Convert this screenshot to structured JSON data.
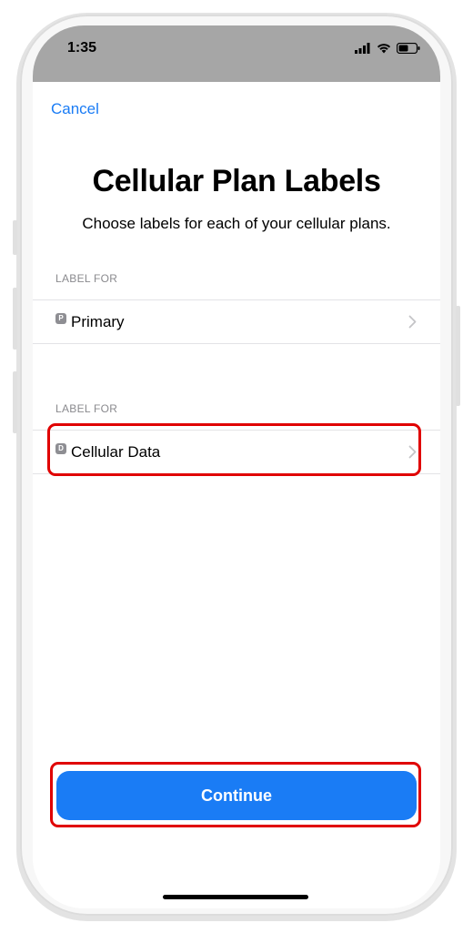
{
  "status_bar": {
    "time": "1:35",
    "icons": [
      "cellular-signal-icon",
      "wifi-icon",
      "battery-icon"
    ]
  },
  "nav": {
    "cancel_label": "Cancel"
  },
  "header": {
    "title": "Cellular Plan Labels",
    "subtitle": "Choose labels for each of your cellular plans."
  },
  "sections": [
    {
      "header": "LABEL FOR",
      "badge": "P",
      "label": "Primary"
    },
    {
      "header": "LABEL FOR",
      "badge": "D",
      "label": "Cellular Data"
    }
  ],
  "footer": {
    "continue_label": "Continue"
  },
  "colors": {
    "accent": "#1a7cf5",
    "highlight": "#e00000",
    "status_bar_bg": "#a6a6a6",
    "badge_bg": "#8e8e93"
  }
}
